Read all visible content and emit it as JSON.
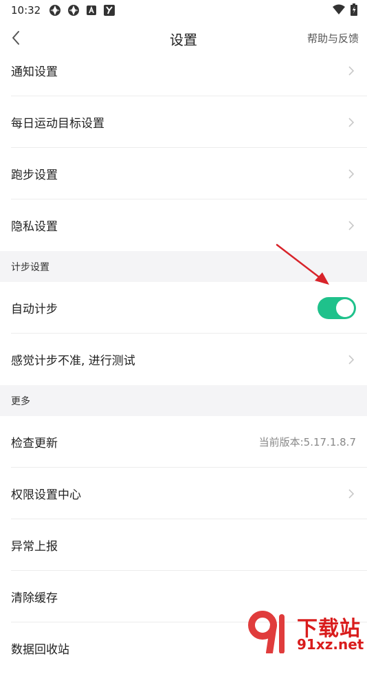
{
  "status_bar": {
    "time": "10:32",
    "left_icons": [
      "notification-app-icon",
      "notification-app-icon",
      "a-app-icon",
      "y-app-icon"
    ],
    "right_icons": [
      "wifi-icon",
      "battery-charging-icon"
    ]
  },
  "nav": {
    "title": "设置",
    "help_label": "帮助与反馈"
  },
  "rows_top": [
    {
      "label": "通知设置"
    },
    {
      "label": "每日运动目标设置"
    },
    {
      "label": "跑步设置"
    },
    {
      "label": "隐私设置"
    }
  ],
  "section_step": {
    "title": "计步设置",
    "auto_step_label": "自动计步",
    "auto_step_enabled": true,
    "test_label": "感觉计步不准, 进行测试"
  },
  "section_more": {
    "title": "更多",
    "check_update_label": "检查更新",
    "version_text": "当前版本:5.17.1.8.7",
    "permission_label": "权限设置中心",
    "report_label": "异常上报",
    "clear_cache_label": "清除缓存",
    "recycle_label": "数据回收站"
  },
  "watermark": {
    "title": "下载站",
    "url": "91xz.net"
  },
  "colors": {
    "toggle_on": "#1fc18b",
    "section_bg": "#f4f4f6",
    "annotation_arrow": "#d8232a",
    "watermark": "#d91c1c"
  }
}
